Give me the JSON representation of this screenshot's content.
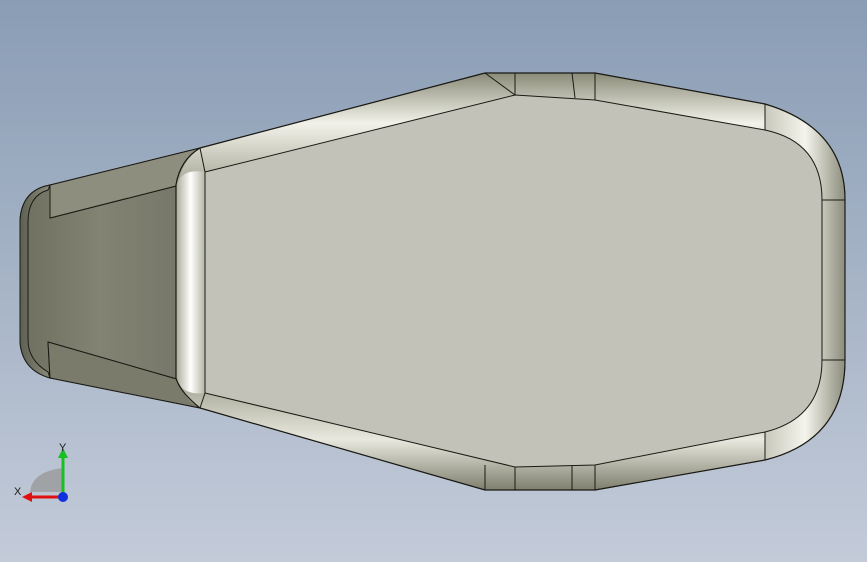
{
  "view": {
    "background_top": "#8a9db5",
    "background_bottom": "#c3cbd9"
  },
  "part": {
    "top_face_color": "#c2c2b8",
    "side_face_color": "#7f8070",
    "fillet_color": "#9a9a88"
  },
  "triad": {
    "x_label": "X",
    "y_label": "Y",
    "x_color": "#e01010",
    "y_color": "#18c020",
    "z_color": "#1030e0"
  }
}
